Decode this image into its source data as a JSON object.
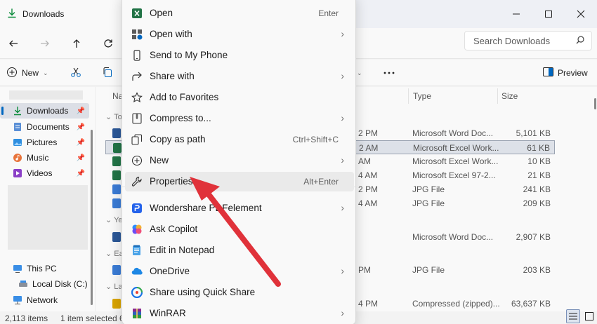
{
  "window": {
    "tab_title": "Downloads",
    "controls": [
      "minimize-icon",
      "maximize-icon",
      "close-icon"
    ]
  },
  "search": {
    "placeholder": "Search Downloads"
  },
  "commandbar": {
    "new_label": "New",
    "preview_label": "Preview"
  },
  "sidebar": {
    "items": [
      {
        "label": "Downloads",
        "icon": "download-icon",
        "pinned": true,
        "active": true
      },
      {
        "label": "Documents",
        "icon": "documents-icon",
        "pinned": true
      },
      {
        "label": "Pictures",
        "icon": "pictures-icon",
        "pinned": true
      },
      {
        "label": "Music",
        "icon": "music-icon",
        "pinned": true
      },
      {
        "label": "Videos",
        "icon": "videos-icon",
        "pinned": true
      },
      {
        "label": "This PC",
        "icon": "pc-icon"
      },
      {
        "label": "Local Disk (C:)",
        "icon": "disk-icon"
      },
      {
        "label": "Network",
        "icon": "network-icon"
      }
    ]
  },
  "columns": {
    "name": "Na",
    "type": "Type",
    "size": "Size"
  },
  "groups": [
    "To",
    "Ye",
    "Ea",
    "La"
  ],
  "files": [
    {
      "date": "2 PM",
      "type": "Microsoft Word Doc...",
      "size": "5,101 KB",
      "color": "#2b5797"
    },
    {
      "date": "2 AM",
      "type": "Microsoft Excel Work...",
      "size": "61 KB",
      "color": "#217346",
      "selected": true
    },
    {
      "date": "AM",
      "type": "Microsoft Excel Work...",
      "size": "10 KB",
      "color": "#217346"
    },
    {
      "date": "4 AM",
      "type": "Microsoft Excel 97-2...",
      "size": "21 KB",
      "color": "#217346"
    },
    {
      "date": "2 PM",
      "type": "JPG File",
      "size": "241 KB",
      "color": "#3a7bd5"
    },
    {
      "date": "4 AM",
      "type": "JPG File",
      "size": "209 KB",
      "color": "#3a7bd5"
    },
    {
      "date": "",
      "type": "Microsoft Word Doc...",
      "size": "2,907 KB",
      "color": "#2b5797"
    },
    {
      "date": "PM",
      "type": "JPG File",
      "size": "203 KB",
      "color": "#3a7bd5"
    },
    {
      "date": "4 PM",
      "type": "Compressed (zipped)...",
      "size": "63,637 KB",
      "color": "#d9a400"
    }
  ],
  "context_menu": {
    "items": [
      {
        "label": "Open",
        "shortcut": "Enter",
        "icon": "excel-icon"
      },
      {
        "label": "Open with",
        "submenu": true,
        "icon": "open-with-icon"
      },
      {
        "label": "Send to My Phone",
        "icon": "phone-icon"
      },
      {
        "label": "Share with",
        "submenu": true,
        "icon": "share-icon"
      },
      {
        "label": "Add to Favorites",
        "icon": "star-icon"
      },
      {
        "label": "Compress to...",
        "submenu": true,
        "icon": "compress-icon"
      },
      {
        "label": "Copy as path",
        "shortcut": "Ctrl+Shift+C",
        "icon": "copy-path-icon"
      },
      {
        "label": "New",
        "submenu": true,
        "icon": "plus-circle-icon"
      },
      {
        "label": "Properties",
        "shortcut": "Alt+Enter",
        "icon": "wrench-icon",
        "highlight": true
      },
      {
        "label": "Wondershare PDFelement",
        "submenu": true,
        "icon": "pdfelement-icon"
      },
      {
        "label": "Ask Copilot",
        "icon": "copilot-icon"
      },
      {
        "label": "Edit in Notepad",
        "icon": "notepad-icon"
      },
      {
        "label": "OneDrive",
        "submenu": true,
        "icon": "onedrive-icon"
      },
      {
        "label": "Share using Quick Share",
        "icon": "quick-share-icon"
      },
      {
        "label": "WinRAR",
        "submenu": true,
        "icon": "winrar-icon"
      }
    ]
  },
  "status": {
    "count": "2,113 items",
    "selected": "1 item selected 6"
  },
  "annotation": {
    "arrow_color": "#e0323a"
  }
}
